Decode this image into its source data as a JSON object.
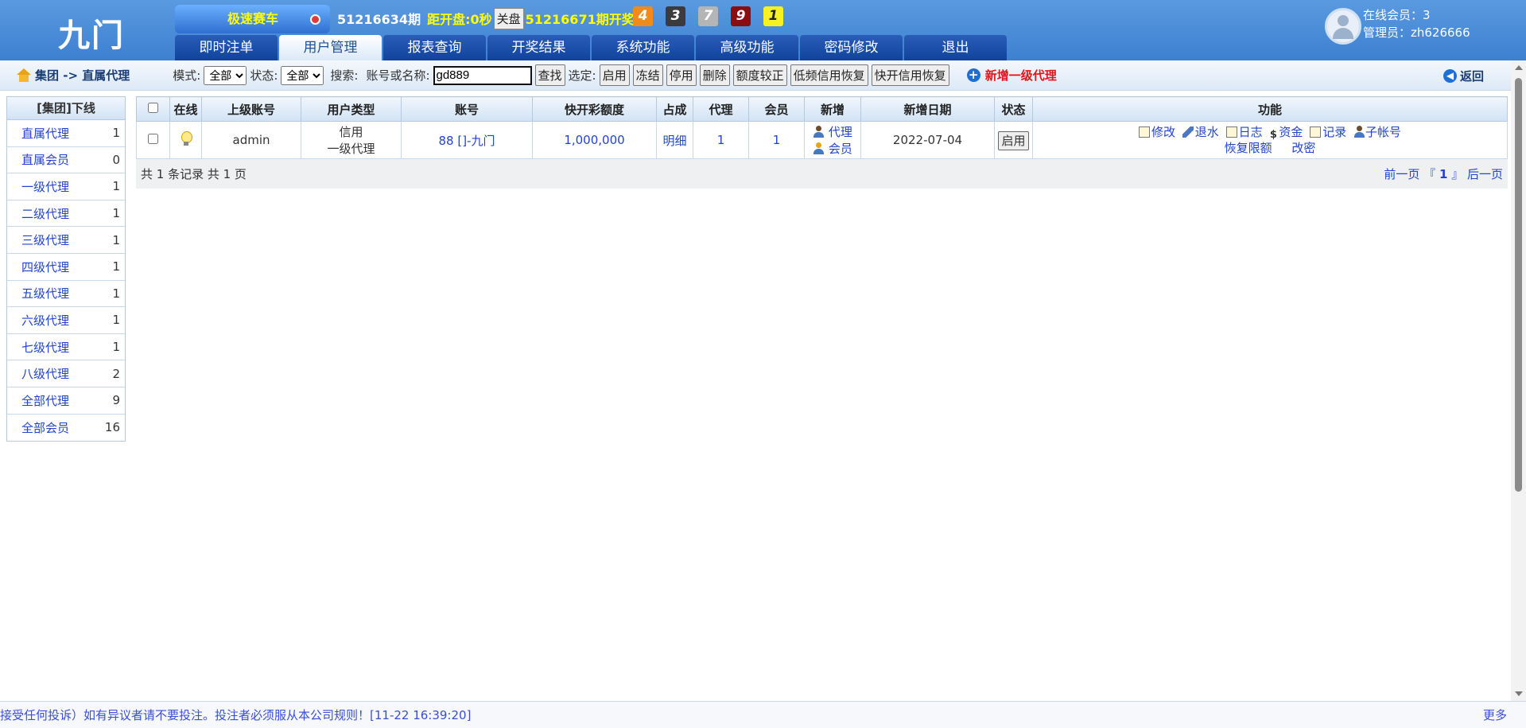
{
  "header": {
    "logo": "九门",
    "game_label": "极速赛车",
    "current_issue": "51216634期",
    "countdown_label": "距开盘:0秒",
    "close_label": "关盘",
    "draw_issue_label": "51216671期开奖:",
    "balls": [
      {
        "num": "4",
        "bg": "#f08a1d",
        "fg": "#ffffff"
      },
      {
        "num": "3",
        "bg": "#3b3b3b",
        "fg": "#ffffff"
      },
      {
        "num": "7",
        "bg": "#b5b5b5",
        "fg": "#ffffff"
      },
      {
        "num": "9",
        "bg": "#8a0d10",
        "fg": "#ffffff"
      },
      {
        "num": "1",
        "bg": "#f6f122",
        "fg": "#222222"
      }
    ],
    "nav": [
      "即时注单",
      "用户管理",
      "报表查询",
      "开奖结果",
      "系统功能",
      "高级功能",
      "密码修改",
      "退出"
    ],
    "online_members": "在线会员：3",
    "admin": "管理员：zh626666"
  },
  "toolbar": {
    "breadcrumb": "集团 -> 直属代理",
    "mode_label": "模式:",
    "mode_value": "全部",
    "status_label": "状态:",
    "status_value": "全部",
    "search_label": "搜索:",
    "account_label": "账号或名称:",
    "search_value": "gd889",
    "find_btn": "查找",
    "selected_label": "选定:",
    "actions": [
      "启用",
      "冻结",
      "停用",
      "删除",
      "额度较正",
      "低频信用恢复",
      "快开信用恢复"
    ],
    "add_agent": "新增一级代理",
    "back": "返回"
  },
  "sidebar": {
    "title": "[集团]下线",
    "items": [
      {
        "label": "直属代理",
        "count": "1"
      },
      {
        "label": "直属会员",
        "count": "0"
      },
      {
        "label": "一级代理",
        "count": "1"
      },
      {
        "label": "二级代理",
        "count": "1"
      },
      {
        "label": "三级代理",
        "count": "1"
      },
      {
        "label": "四级代理",
        "count": "1"
      },
      {
        "label": "五级代理",
        "count": "1"
      },
      {
        "label": "六级代理",
        "count": "1"
      },
      {
        "label": "七级代理",
        "count": "1"
      },
      {
        "label": "八级代理",
        "count": "2"
      },
      {
        "label": "全部代理",
        "count": "9"
      },
      {
        "label": "全部会员",
        "count": "16"
      }
    ]
  },
  "table": {
    "headers": [
      "在线",
      "上级账号",
      "用户类型",
      "账号",
      "快开彩额度",
      "占成",
      "代理",
      "会员",
      "新增",
      "新增日期",
      "状态",
      "功能"
    ],
    "rows": [
      {
        "parent": "admin",
        "type_line1": "信用",
        "type_line2": "一级代理",
        "account": "88 []-九门",
        "quota": "1,000,000",
        "share": "明细",
        "agents": "1",
        "members": "1",
        "add_agent": "代理",
        "add_member": "会员",
        "date": "2022-07-04",
        "status": "启用",
        "functions_line1": [
          "修改",
          "退水",
          "日志",
          "资金",
          "记录",
          "子帐号"
        ],
        "functions_line2": [
          "恢复限额",
          "改密"
        ]
      }
    ],
    "summary": "共 1 条记录 共 1 页",
    "pager": {
      "prev": "前一页",
      "left_bracket": "『",
      "current": "1",
      "right_bracket": "』",
      "next": "后一页"
    }
  },
  "marquee": {
    "text": "接受任何投诉）如有异议者请不要投注。投注者必须服从本公司规则！[11-22 16:39:20]",
    "more": "更多"
  }
}
